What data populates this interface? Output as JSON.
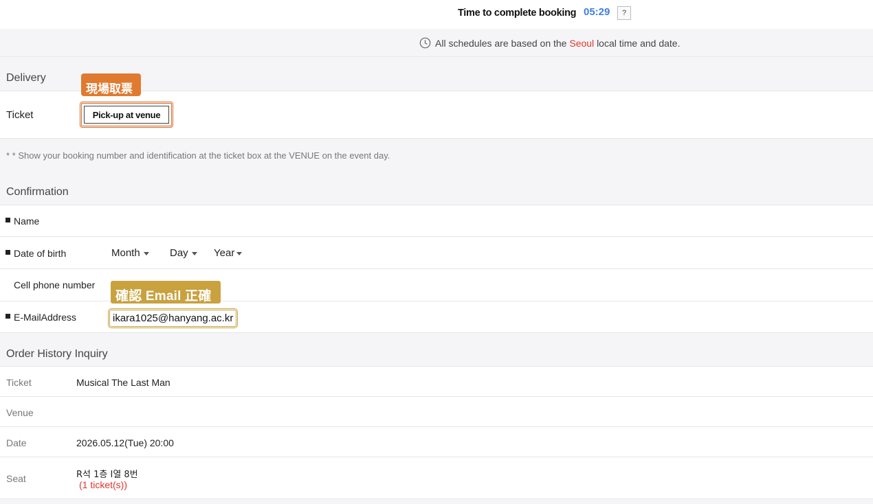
{
  "timer": {
    "label": "Time to complete booking",
    "value": "05:29",
    "help_label": "?"
  },
  "timezone": {
    "icon": "clock-icon",
    "prefix": "All schedules are based on the",
    "city": "Seoul",
    "suffix": "local time and date.",
    "city_color": "#e0342a"
  },
  "delivery": {
    "section_title": "Delivery",
    "annotation": "現場取票",
    "ticket_label": "Ticket",
    "pickup_button": "Pick-up at venue",
    "notice": "* * Show your booking number and identification at the ticket box at the VENUE on the event day."
  },
  "confirmation": {
    "section_title": "Confirmation",
    "name_label": "Name",
    "dob_label": "Date of birth",
    "dob_month": "Month",
    "dob_day": "Day",
    "dob_year": "Year",
    "phone_label": "Cell phone number",
    "email_annotation": "確認 Email 正確",
    "email_label": "E-MailAddress",
    "email_value": "ikara1025@hanyang.ac.kr"
  },
  "order_history": {
    "section_title": "Order History Inquiry",
    "ticket_label": "Ticket",
    "ticket_value": "Musical The Last Man",
    "venue_label": "Venue",
    "venue_value": "",
    "date_label": "Date",
    "date_value": "2026.05.12(Tue) 20:00",
    "seat_label": "Seat",
    "seat_value": "R석 1층 I열 8번",
    "seat_count": "(1 ticket(s))"
  },
  "colors": {
    "accent_blue": "#3d7fe0",
    "annotation_orange": "#e07a30",
    "annotation_gold": "#c9a13f"
  }
}
